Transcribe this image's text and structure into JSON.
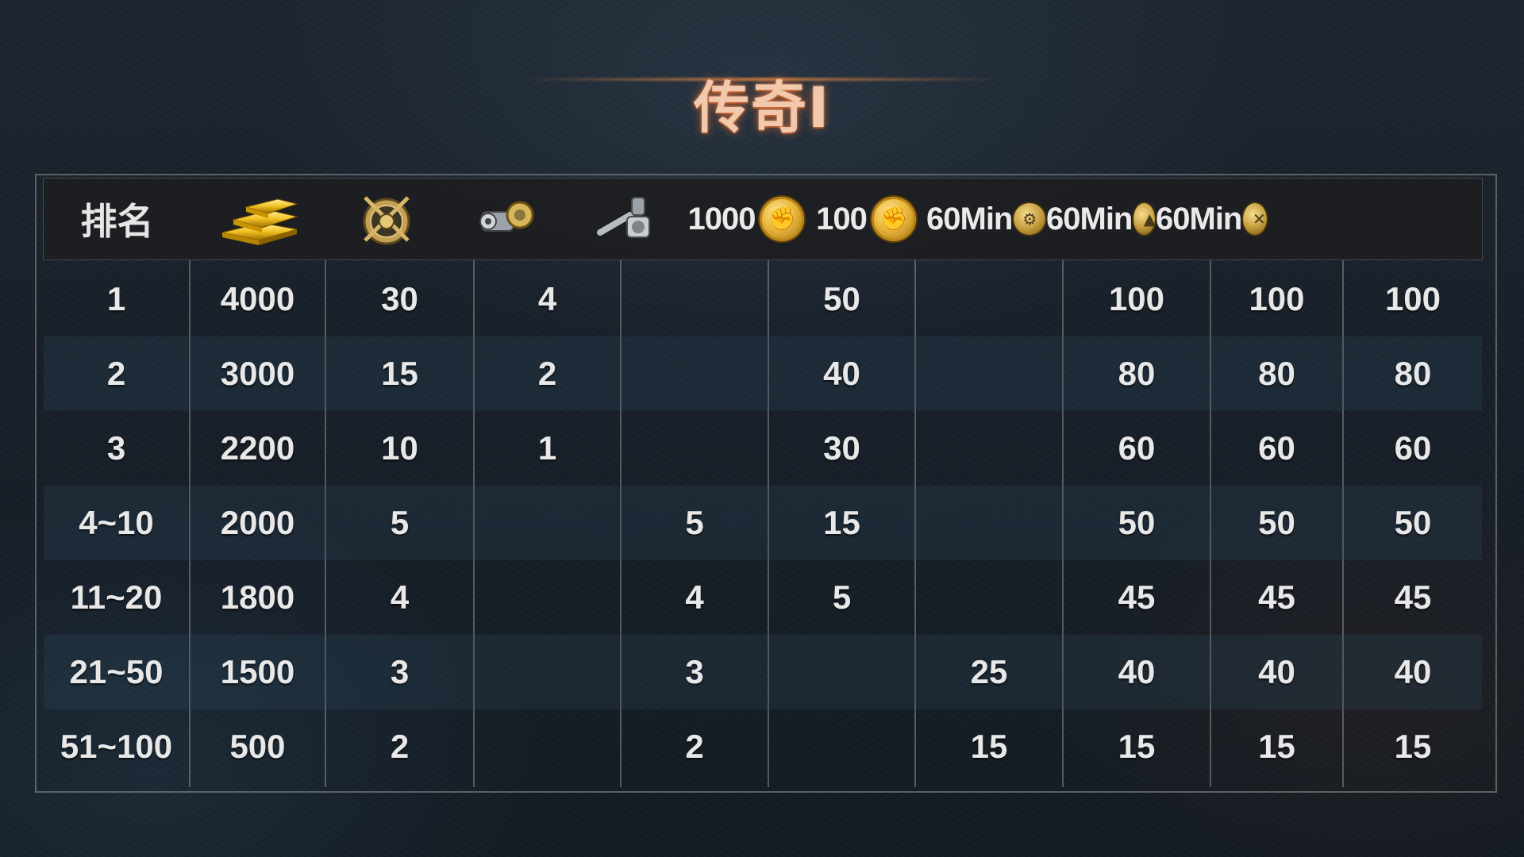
{
  "title": "传奇I",
  "header": {
    "rank_label": "排名",
    "col_gold_icon": "gold-bars-icon",
    "col_medal_icon": "crossed-rifles-medal-icon",
    "col_part_icon": "engine-part-icon",
    "col_tool_icon": "wrench-part-icon",
    "col_fist_1000": "1000",
    "col_fist_100": "100",
    "col_speedup_1": "60Min",
    "col_speedup_2": "60Min",
    "col_speedup_3": "60Min"
  },
  "rows": [
    {
      "rank": "1",
      "gold": "4000",
      "medal": "30",
      "part": "4",
      "tool": "",
      "fist1000": "50",
      "fist100": "",
      "s1": "100",
      "s2": "100",
      "s3": "100"
    },
    {
      "rank": "2",
      "gold": "3000",
      "medal": "15",
      "part": "2",
      "tool": "",
      "fist1000": "40",
      "fist100": "",
      "s1": "80",
      "s2": "80",
      "s3": "80"
    },
    {
      "rank": "3",
      "gold": "2200",
      "medal": "10",
      "part": "1",
      "tool": "",
      "fist1000": "30",
      "fist100": "",
      "s1": "60",
      "s2": "60",
      "s3": "60"
    },
    {
      "rank": "4~10",
      "gold": "2000",
      "medal": "5",
      "part": "",
      "tool": "5",
      "fist1000": "15",
      "fist100": "",
      "s1": "50",
      "s2": "50",
      "s3": "50"
    },
    {
      "rank": "11~20",
      "gold": "1800",
      "medal": "4",
      "part": "",
      "tool": "4",
      "fist1000": "5",
      "fist100": "",
      "s1": "45",
      "s2": "45",
      "s3": "45"
    },
    {
      "rank": "21~50",
      "gold": "1500",
      "medal": "3",
      "part": "",
      "tool": "3",
      "fist1000": "",
      "fist100": "25",
      "s1": "40",
      "s2": "40",
      "s3": "40"
    },
    {
      "rank": "51~100",
      "gold": "500",
      "medal": "2",
      "part": "",
      "tool": "2",
      "fist1000": "",
      "fist100": "15",
      "s1": "15",
      "s2": "15",
      "s3": "15"
    }
  ],
  "colors": {
    "title": "#f3c9ad",
    "title_glow": "#ff7832",
    "header_bg": "#1e1e20",
    "row_shade": "#325069",
    "text": "#e8e8e8"
  }
}
